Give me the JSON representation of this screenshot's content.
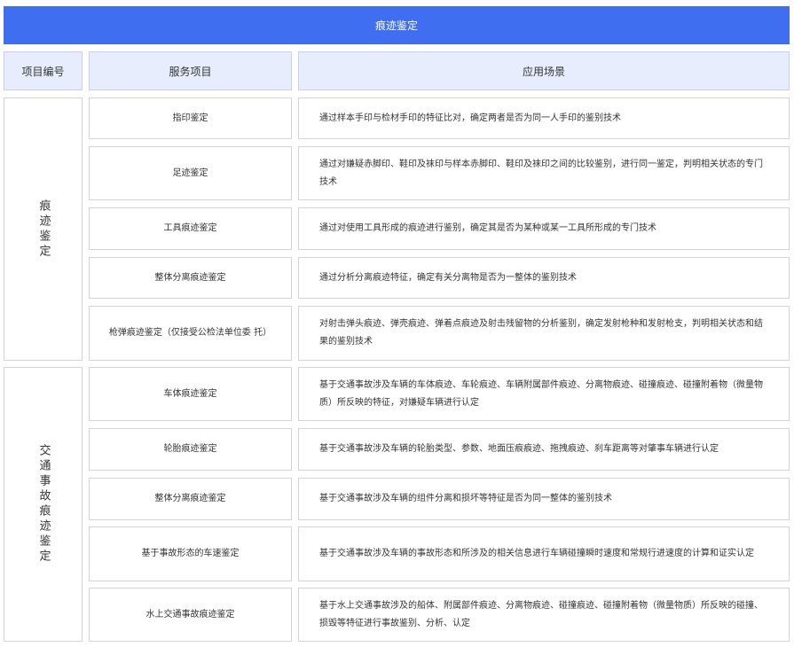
{
  "banner": {
    "title": "痕迹鉴定"
  },
  "headers": {
    "code": "项目编号",
    "service": "服务项目",
    "scene": "应用场景"
  },
  "categories": [
    {
      "name": "痕迹鉴定",
      "rows": [
        {
          "service": "指印鉴定",
          "scene": "通过样本手印与检材手印的特征比对，确定两者是否为同一人手印的鉴别技术"
        },
        {
          "service": "足迹鉴定",
          "scene": "通过对嫌疑赤脚印、鞋印及袜印与样本赤脚印、鞋印及袜印之间的比较鉴别，进行同一鉴定，判明相关状态的专门技术"
        },
        {
          "service": "工具痕迹鉴定",
          "scene": "通过对使用工具形成的痕迹进行鉴别，确定其是否为某种或某一工具所形成的专门技术"
        },
        {
          "service": "整体分离痕迹鉴定",
          "scene": "通过分析分离痕迹特征，确定有关分离物是否为一整体的鉴别技术"
        },
        {
          "service": "枪弹痕迹鉴定（仅接受公检法单位委 托）",
          "scene": "对射击弹头痕迹、弹壳痕迹、弹着点痕迹及射击残留物的分析鉴别，确定发射枪种和发射枪支，判明相关状态和结果的鉴别技术"
        }
      ]
    },
    {
      "name": "交通事故痕迹鉴定",
      "rows": [
        {
          "service": "车体痕迹鉴定",
          "scene": "基于交通事故涉及车辆的车体痕迹、车轮痕迹、车辆附属部件痕迹、分离物痕迹、碰撞痕迹、碰撞附着物（微量物质）所反映的特征，对嫌疑车辆进行认定"
        },
        {
          "service": "轮胎痕迹鉴定",
          "scene": "基于交通事故涉及车辆的轮胎类型、参数、地面压痕痕迹、拖拽痕迹、刹车距离等对肇事车辆进行认定"
        },
        {
          "service": "整体分离痕迹鉴定",
          "scene": "基于交通事故涉及车辆的组件分离和损坏等特征是否为同一整体的鉴别技术"
        },
        {
          "service": "基于事故形态的车速鉴定",
          "scene": "基于交通事故涉及车辆的事故形态和所涉及的相关信息进行车辆碰撞瞬时速度和常规行进速度的计算和证实认定"
        },
        {
          "service": "水上交通事故痕迹鉴定",
          "scene": "基于水上交通事故涉及的船体、附属部件痕迹、分离物痕迹、碰撞痕迹、碰撞附着物（微量物质）所反映的碰撞、损毁等特征进行事故鉴别、分析、认定"
        }
      ]
    }
  ]
}
